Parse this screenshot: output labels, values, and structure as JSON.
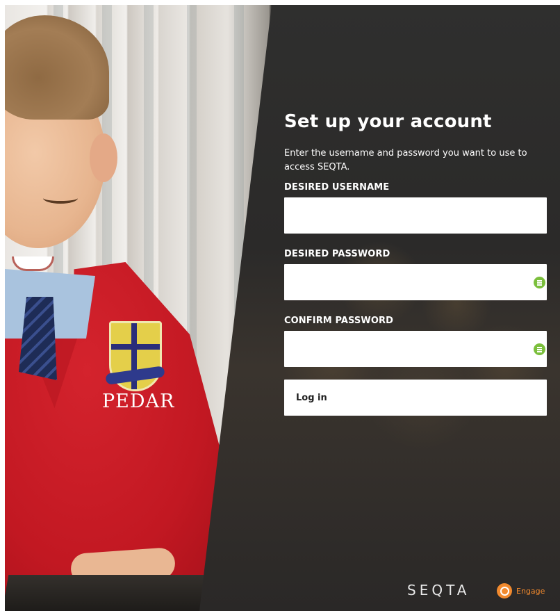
{
  "page": {
    "title": "Set up your account",
    "description": "Enter the username and password you want to use to access SEQTA."
  },
  "form": {
    "username": {
      "label": "DESIRED USERNAME",
      "value": "",
      "placeholder": ""
    },
    "password": {
      "label": "DESIRED PASSWORD",
      "value": "",
      "placeholder": "",
      "icon": "password-manager-icon"
    },
    "confirm_password": {
      "label": "CONFIRM PASSWORD",
      "value": "",
      "placeholder": "",
      "icon": "password-manager-icon"
    },
    "submit_label": "Log in"
  },
  "background": {
    "embroidery_text": "PEDAR"
  },
  "footer": {
    "brand": "SEQTA",
    "product": "Engage",
    "product_icon": "engage-logo-icon"
  },
  "colors": {
    "overlay": "#2b2a29",
    "accent_green": "#7bbf3c",
    "engage_orange": "#f28a2e",
    "sweater_red": "#c21822"
  }
}
